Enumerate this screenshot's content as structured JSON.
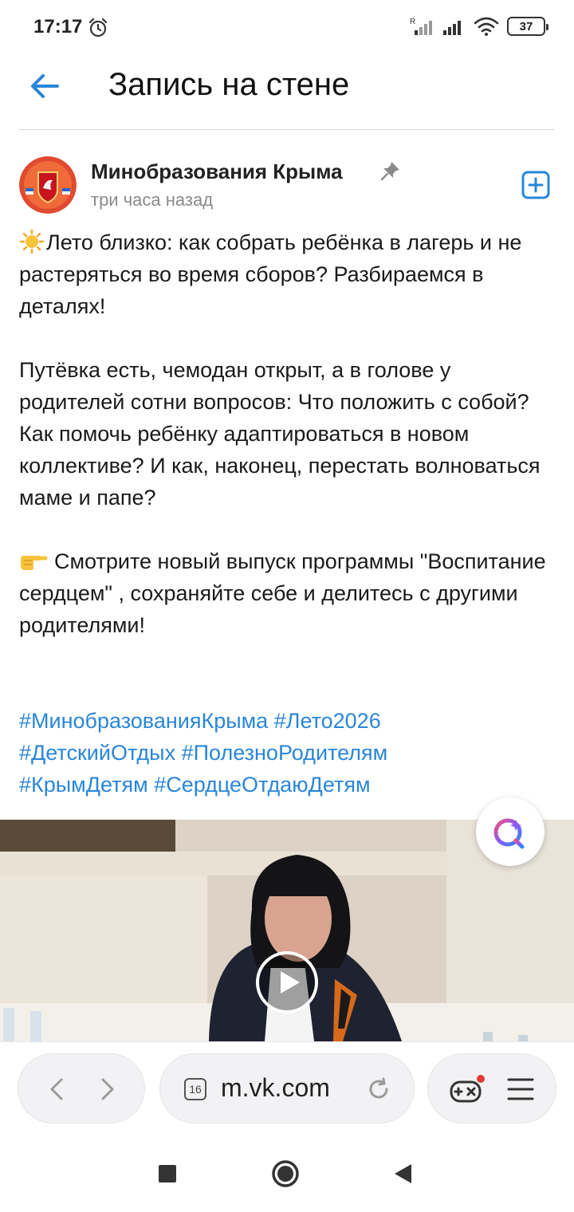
{
  "status_bar": {
    "time": "17:17",
    "battery": "37",
    "icons": [
      "alarm-icon",
      "signal-icon",
      "signal-icon",
      "wifi-icon",
      "battery-icon"
    ]
  },
  "header": {
    "title": "Запись на стене",
    "back_icon": "arrow-left-icon"
  },
  "post": {
    "author": "Минобразования Крыма",
    "time": "три часа назад",
    "pinned_icon": "pin-icon",
    "add_icon": "plus-square-icon",
    "paragraphs": [
      "Лето близко: как собрать ребёнка в лагерь и не растеряться во время сборов? Разбираемся в деталях!",
      "Путёвка есть, чемодан открыт, а в голове у родителей сотни вопросов: Что положить с собой? Как помочь ребёнку адаптироваться в новом коллективе? И как, наконец, перестать волноваться маме и папе?",
      "Смотрите новый выпуск программы \"Воспитание сердцем\" , сохраняйте себе и делитесь с другими родителями!"
    ],
    "hashtags": [
      "#МинобразованияКрыма",
      "#Лето2026",
      "#ДетскийОтдых",
      "#ПолезноРодителям",
      "#КрымДетям",
      "#СердцеОтдаюДетям"
    ],
    "link_color": "#2a86d8"
  },
  "browser": {
    "tab_count": "16",
    "url": "m.vk.com"
  }
}
